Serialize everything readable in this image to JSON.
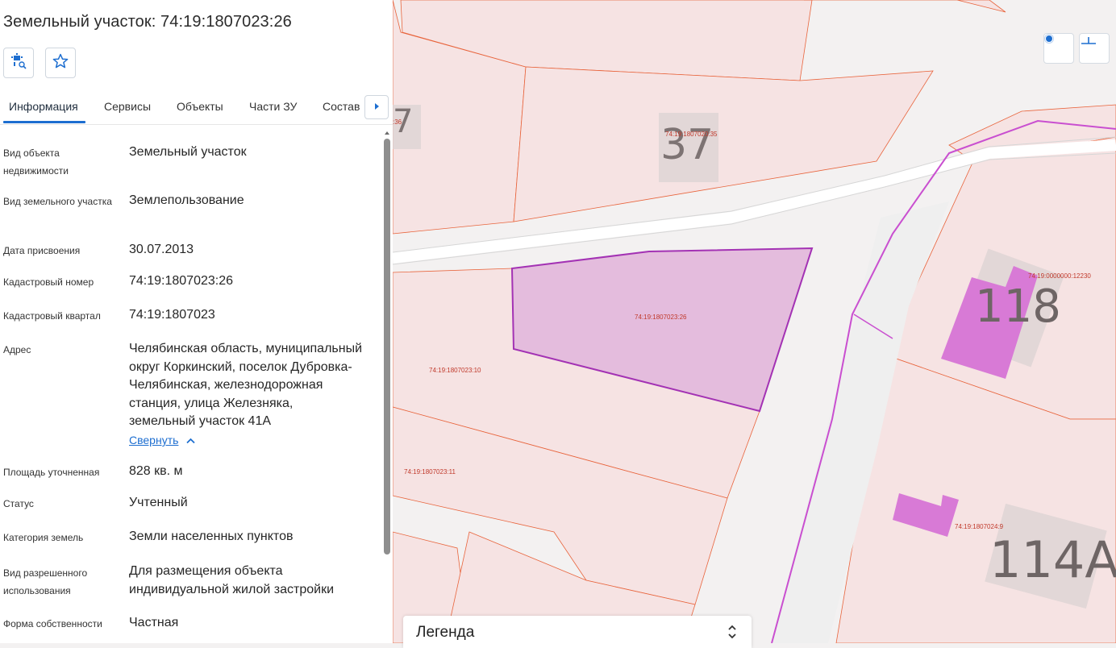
{
  "panel": {
    "title": "Земельный участок: 74:19:1807023:26",
    "tools": [
      {
        "icon": "map-search-icon"
      },
      {
        "icon": "star-icon"
      }
    ],
    "tabs": [
      {
        "label": "Информация",
        "active": true
      },
      {
        "label": "Сервисы"
      },
      {
        "label": "Объекты"
      },
      {
        "label": "Части ЗУ"
      },
      {
        "label": "Состав"
      }
    ],
    "rows": [
      {
        "label": "Вид объекта недвижимости",
        "value": "Земельный участок"
      },
      {
        "label": "Вид земельного участка",
        "value": "Землепользование"
      },
      {
        "label": "Дата присвоения",
        "value": "30.07.2013"
      },
      {
        "label": "Кадастровый номер",
        "value": "74:19:1807023:26"
      },
      {
        "label": "Кадастровый квартал",
        "value": "74:19:1807023"
      },
      {
        "label": "Адрес",
        "value": "Челябинская область, муниципальный округ Коркинский, поселок Дубровка-Челябинская, железнодорожная станция, улица Железняка, земельный участок 41А"
      },
      {
        "label": "Площадь уточненная",
        "value": "828 кв. м"
      },
      {
        "label": "Статус",
        "value": "Учтенный"
      },
      {
        "label": "Категория земель",
        "value": "Земли населенных пунктов"
      },
      {
        "label": "Вид разрешенного использования",
        "value": "Для размещения объекта индивидуальной жилой застройки"
      },
      {
        "label": "Форма собственности",
        "value": "Частная"
      }
    ],
    "collapse_link": "Свернуть"
  },
  "map": {
    "parcel_labels": {
      "selected": "74:19:1807023:26",
      "p35": "74:19:1807020:35",
      "p10": "74:19:1807023:10",
      "p11": "74:19:1807023:11",
      "p12230": "74:19:0000000:12230",
      "p9": "74:19:1807024:9",
      "p36": ":36"
    },
    "house_numbers": {
      "h37": "37",
      "h118": "118",
      "h114a": "114А",
      "h7": "7"
    },
    "controls": [
      {
        "icon": "locate-icon"
      },
      {
        "icon": "measure-icon"
      }
    ],
    "legend_title": "Легенда",
    "colors": {
      "parcel_fill": "#f6e2e2",
      "parcel_line": "#e8643c",
      "selected": "#a332b4",
      "building": "#d87ad6"
    }
  }
}
